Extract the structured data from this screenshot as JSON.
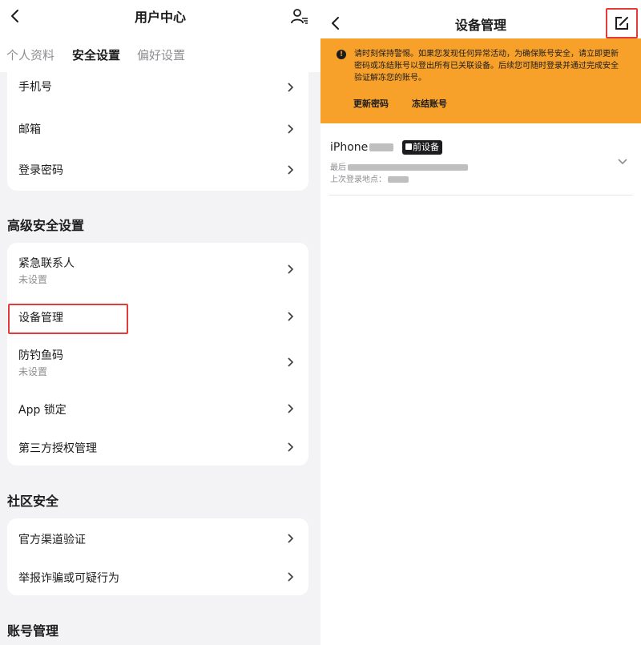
{
  "left": {
    "header": {
      "title": "用户中心"
    },
    "tabs": [
      "个人资料",
      "安全设置",
      "偏好设置"
    ],
    "basic_items": [
      "手机号",
      "邮箱",
      "登录密码"
    ],
    "advanced": {
      "title": "高级安全设置",
      "items": [
        {
          "label": "紧急联系人",
          "sub": "未设置"
        },
        {
          "label": "设备管理",
          "sub": ""
        },
        {
          "label": "防钓鱼码",
          "sub": "未设置"
        },
        {
          "label": "App 锁定",
          "sub": ""
        },
        {
          "label": "第三方授权管理",
          "sub": ""
        }
      ]
    },
    "community": {
      "title": "社区安全",
      "items": [
        "官方渠道验证",
        "举报诈骗或可疑行为"
      ]
    },
    "account": {
      "title": "账号管理"
    }
  },
  "right": {
    "header": {
      "title": "设备管理"
    },
    "banner": {
      "text": "请时刻保持警惕。如果您发现任何异常活动，为确保账号安全，请立即更新密码或冻结账号以登出所有已关联设备。后续您可随时登录并通过完成安全验证解冻您的账号。",
      "update_password": "更新密码",
      "freeze_account": "冻结账号"
    },
    "device": {
      "name_prefix": "iPhone",
      "badge": "前设备",
      "last_label": "最后",
      "location_label": "上次登录地点："
    }
  },
  "colors": {
    "warning": "#f7a12a",
    "highlight": "#e33a3a"
  }
}
